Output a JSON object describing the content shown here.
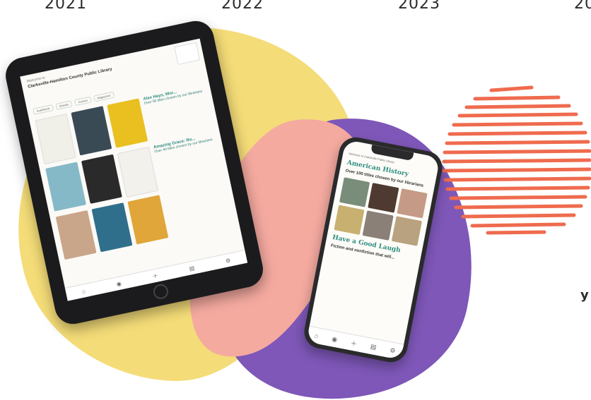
{
  "timeline": {
    "years": [
      "2021",
      "2022",
      "2023",
      "20"
    ],
    "side_letter": "y"
  },
  "colors": {
    "yellow_blob": "#f4dc78",
    "pink_blob": "#f5aaa0",
    "purple_blob": "#7e57b8",
    "orange_scribble": "#ef6b4e"
  },
  "tablet": {
    "welcome": "Welcome to",
    "title": "Clarksville-Hamilton County Public Library",
    "tabs": [
      "Audiobook",
      "Ebooks",
      "Comics",
      "Magazines"
    ],
    "card1_title": "Alex Hays, Wor...",
    "card1_text": "Over 50 titles chosen by our librarians",
    "card2_title": "Amazing Grace: Ro...",
    "card2_text": "Over 40 titles chosen by our librarians"
  },
  "phone": {
    "header": "Welcome to Clarksville Public Library",
    "section1": "American History",
    "section1_sub": "Over 100 titles chosen by our librarians",
    "section2": "Have a Good Laugh",
    "section2_sub": "Fiction and nonfiction that will..."
  }
}
